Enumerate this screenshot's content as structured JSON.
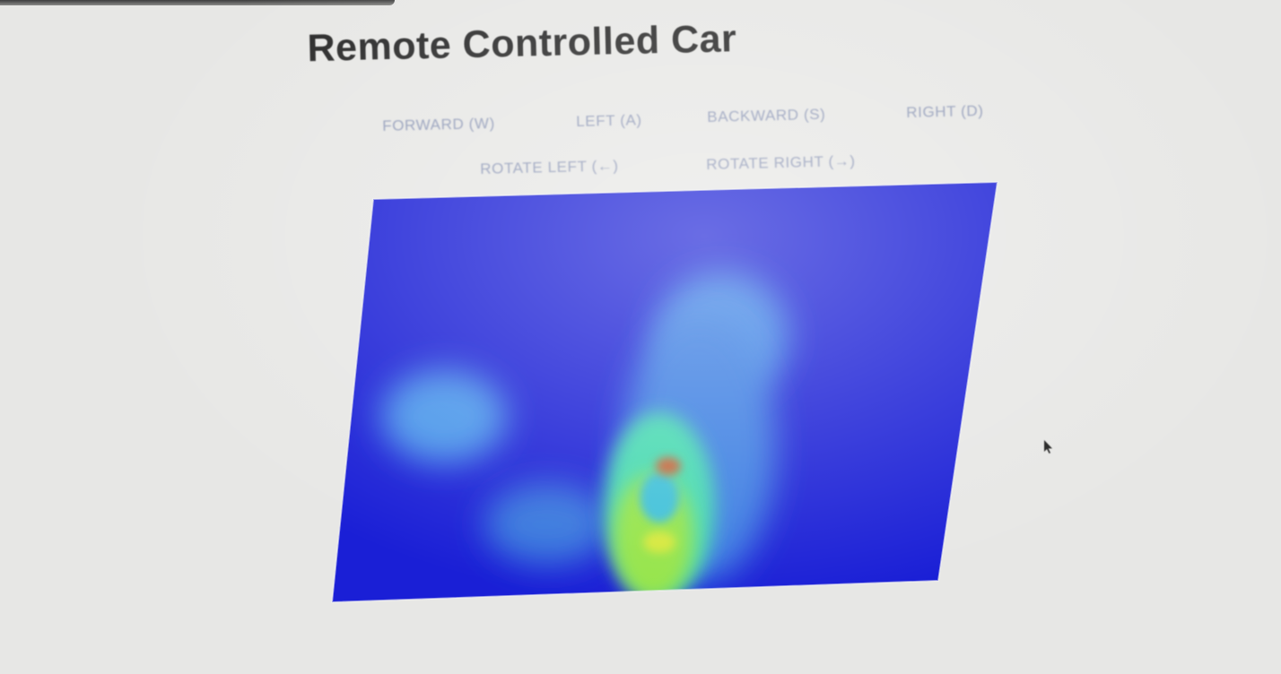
{
  "page": {
    "title": "Remote Controlled Car"
  },
  "controls": {
    "forward": "FORWARD (W)",
    "left": "LEFT (A)",
    "backward": "BACKWARD (S)",
    "right": "RIGHT (D)",
    "rotate_left": "ROTATE LEFT (←)",
    "rotate_right": "ROTATE RIGHT (→)"
  },
  "colors": {
    "background": "#e7e7e5",
    "title": "#262626",
    "control_text": "#8e98b6",
    "thermal_background": "#1a1fd6",
    "thermal_cool": "#4f9fe8",
    "thermal_warm": "#4ee0a0",
    "thermal_hot": "#9fe83c",
    "thermal_hotspot": "#c4683c"
  },
  "icons": {
    "cursor": "mouse-pointer-icon"
  }
}
